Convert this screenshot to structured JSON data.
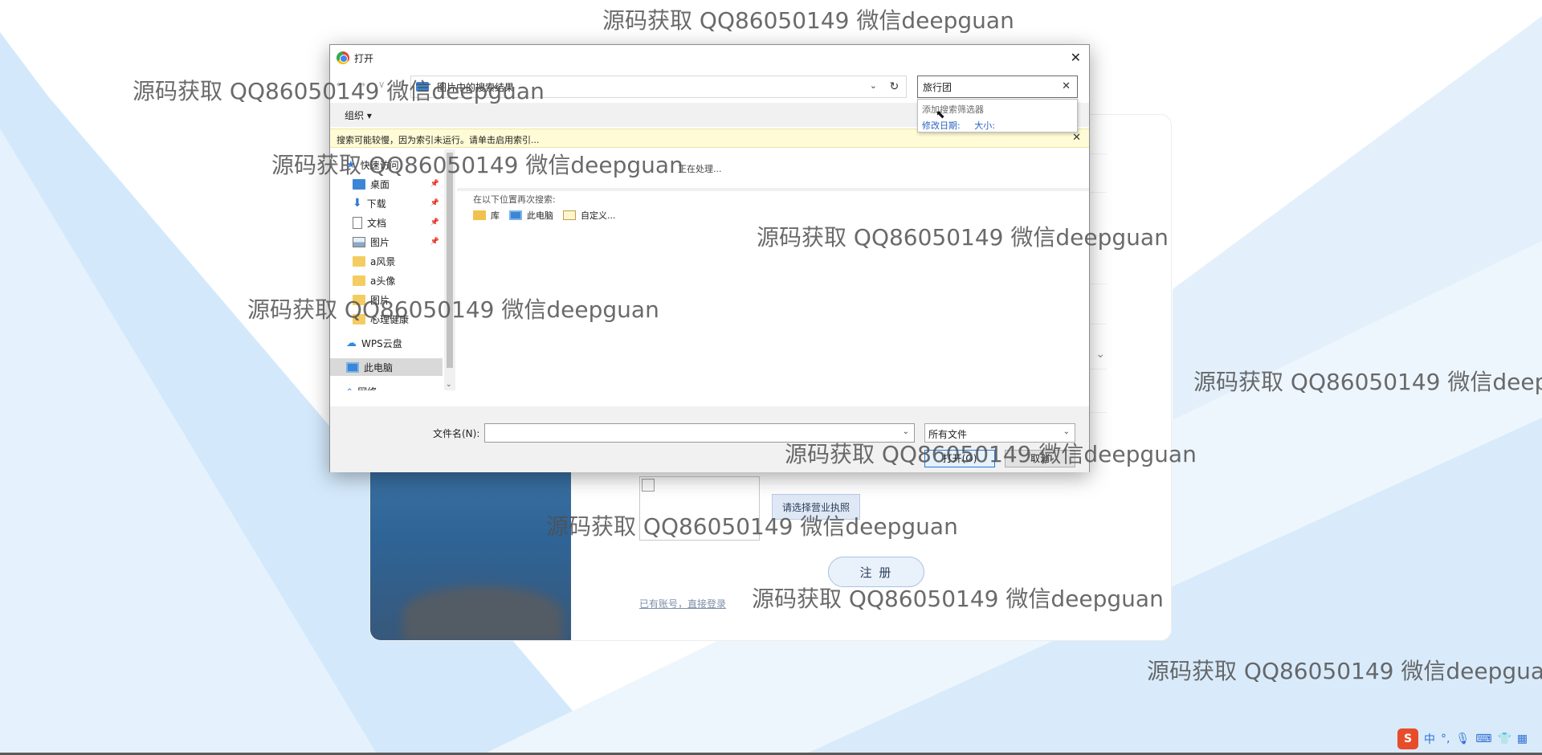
{
  "dialog": {
    "title": "打开",
    "address": "图片中的搜索结果",
    "search_value": "旅行团",
    "search_popup": {
      "title": "添加搜索筛选器",
      "filter_date": "修改日期:",
      "filter_size": "大小:"
    },
    "organize_label": "组织 ▾",
    "info_message": "搜索可能较慢，因为索引未运行。请单击启用索引...",
    "nav_items": [
      {
        "label": "快速访问"
      },
      {
        "label": "桌面"
      },
      {
        "label": "下载"
      },
      {
        "label": "文档"
      },
      {
        "label": "图片"
      },
      {
        "label": "a风景"
      },
      {
        "label": "a头像"
      },
      {
        "label": "图片"
      },
      {
        "label": "心理健康"
      },
      {
        "label": "WPS云盘"
      },
      {
        "label": "此电脑"
      },
      {
        "label": "网络"
      }
    ],
    "processing_text": "正在处理...",
    "search_again_label": "在以下位置再次搜索:",
    "search_again_locations": [
      "库",
      "此电脑",
      "自定义..."
    ],
    "filename_label": "文件名(N):",
    "filename_value": "",
    "filetype_value": "所有文件",
    "open_button": "打开(O)",
    "cancel_button": "取消"
  },
  "background_form": {
    "upload_button": "请选择营业执照",
    "register_button": "注 册",
    "login_link": "已有账号，直接登录"
  },
  "watermark_text": "源码获取 QQ86050149 微信deepguan",
  "ime": {
    "logo": "S",
    "mode": "中"
  },
  "colors": {
    "accent_blue": "#2a78d4",
    "info_bar": "#fffbd6",
    "bg_shape_light": "#d6ebfb"
  }
}
